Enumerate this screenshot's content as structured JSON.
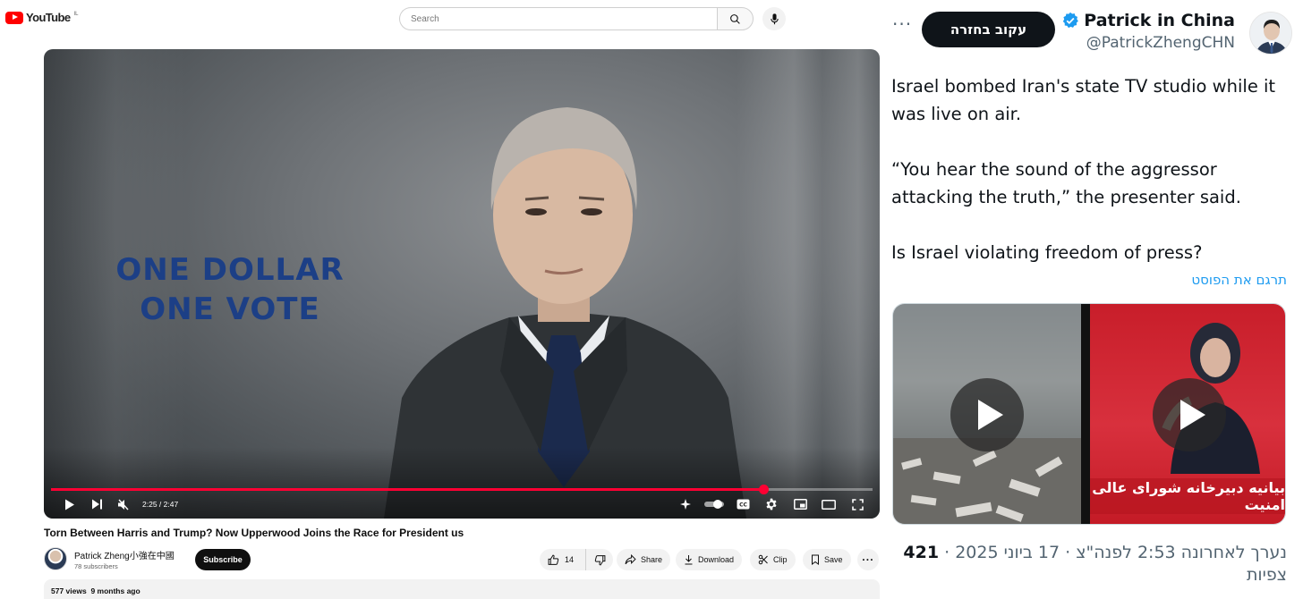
{
  "youtube": {
    "logo_text": "YouTube",
    "logo_region": "IL",
    "search_placeholder": "Search",
    "video": {
      "overlay_line1": "ONE DOLLAR",
      "overlay_line2": "ONE VOTE",
      "time_display": "2:25 / 2:47",
      "progress_fraction": 0.867,
      "title": "Torn Between Harris and Trump? Now Upperwood Joins the Race for President us"
    },
    "channel": {
      "name": "Patrick Zheng小強在中國",
      "subscribers": "78 subscribers",
      "subscribe_label": "Subscribe"
    },
    "actions": {
      "likes": "14",
      "share": "Share",
      "download": "Download",
      "clip": "Clip",
      "save": "Save",
      "more": "···"
    },
    "description": {
      "views": "577 views",
      "age": "9 months ago"
    }
  },
  "tweet": {
    "more_label": "···",
    "follow_label": "עקוב בחזרה",
    "display_name": "Patrick in China",
    "handle": "@PatrickZhengCHN",
    "paragraphs": [
      "Israel bombed Iran's state TV studio while it was live on air.",
      "“You hear the sound of the aggressor attacking the truth,” the presenter said.",
      "Is Israel violating freedom of press?"
    ],
    "translate_label": "תרגם את הפוסט",
    "media_banner": "بیانیه دبیرخانه شورای عالی امنیت",
    "meta_line": "נערך לאחרונה 2:53 לפנה\"צ · 17 ביוני 2025 · ",
    "views_count": "421",
    "views_label": "צפיות"
  },
  "colors": {
    "yt_red": "#ff0000",
    "progress_red": "#ff0033",
    "overlay_blue": "#1c3f86",
    "x_blue": "#1d9bf0",
    "verified_blue": "#1d9bf0"
  }
}
